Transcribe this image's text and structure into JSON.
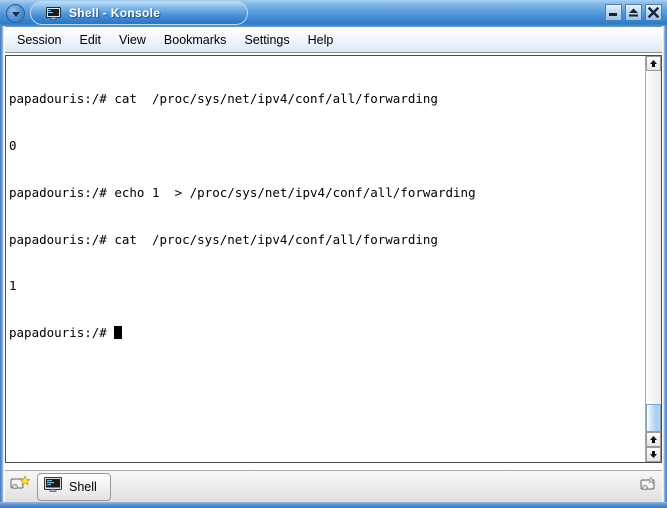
{
  "window": {
    "title": "Shell - Konsole",
    "title_icon": "monitor-icon",
    "menu_button_icon": "window-menu-chevron-down-icon",
    "controls": [
      {
        "name": "minimize",
        "icon": "minimize-icon"
      },
      {
        "name": "maximize",
        "icon": "maximize-icon"
      },
      {
        "name": "close",
        "icon": "close-icon"
      }
    ]
  },
  "menubar": {
    "items": [
      {
        "label": "Session"
      },
      {
        "label": "Edit"
      },
      {
        "label": "View"
      },
      {
        "label": "Bookmarks"
      },
      {
        "label": "Settings"
      },
      {
        "label": "Help"
      }
    ]
  },
  "terminal": {
    "lines": [
      "papadouris:/# cat  /proc/sys/net/ipv4/conf/all/forwarding",
      "0",
      "papadouris:/# echo 1  > /proc/sys/net/ipv4/conf/all/forwarding",
      "papadouris:/# cat  /proc/sys/net/ipv4/conf/all/forwarding",
      "1"
    ],
    "prompt": "papadouris:/# ",
    "cursor": "block-cursor",
    "foreground_color": "#000000",
    "background_color": "#ffffff"
  },
  "scrollbar": {
    "top_arrow_icon": "scroll-up-icon",
    "bottom_up_arrow_icon": "scroll-up-icon",
    "bottom_down_arrow_icon": "scroll-down-icon",
    "thumb": "scrollbar-thumb"
  },
  "taskbar": {
    "new_session_icon": "new-session-icon",
    "sessions": [
      {
        "label": "Shell",
        "icon": "monitor-icon",
        "active": true
      }
    ],
    "right_icon": "session-options-icon"
  },
  "colors": {
    "titlebar_blue": "#4e93d8",
    "titlebar_highlight": "#a8cdf0",
    "frame_blue": "#3c78bc",
    "menubar_bg": "#eef4fa",
    "terminal_bg": "#ffffff",
    "terminal_fg": "#000000"
  }
}
